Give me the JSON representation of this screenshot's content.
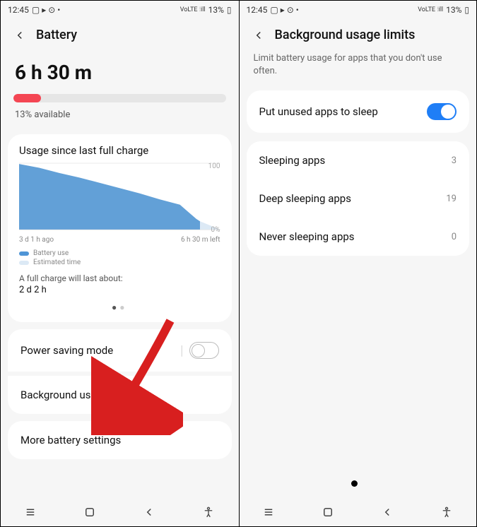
{
  "statusbar": {
    "time": "12:45",
    "battery_pct": "13%"
  },
  "left": {
    "title": "Battery",
    "remaining": "6 h 30 m",
    "progress_pct": 13,
    "available": "13% available",
    "card_title": "Usage since last full charge",
    "x_start": "3 d 1 h ago",
    "x_end": "6 h 30 m left",
    "legend1": "Battery use",
    "legend2": "Estimated time",
    "fc_label": "A full charge will last about:",
    "fc_value": "2 d 2 h",
    "power_saving": "Power saving mode",
    "bg_limits": "Background usage limits",
    "more": "More battery settings"
  },
  "right": {
    "title": "Background usage limits",
    "subtitle": "Limit battery usage for apps that you don't use often.",
    "toggle_label": "Put unused apps to sleep",
    "sleeping": "Sleeping apps",
    "sleeping_n": "3",
    "deep": "Deep sleeping apps",
    "deep_n": "19",
    "never": "Never sleeping apps",
    "never_n": "0"
  },
  "chart_data": {
    "type": "area",
    "x": [
      0,
      10,
      20,
      30,
      40,
      50,
      60,
      70,
      80,
      84,
      88,
      90,
      100
    ],
    "values": [
      98,
      92,
      85,
      78,
      70,
      62,
      54,
      46,
      38,
      27,
      16,
      13,
      0
    ],
    "ylim": [
      0,
      100
    ],
    "xlabel_left": "3 d 1 h ago",
    "xlabel_right": "6 h 30 m left",
    "ylabel_top": "100",
    "ylabel_bot": "0%",
    "series": [
      {
        "name": "Battery use",
        "color": "#4f95d6"
      },
      {
        "name": "Estimated time",
        "color": "#dce9f5"
      }
    ]
  }
}
